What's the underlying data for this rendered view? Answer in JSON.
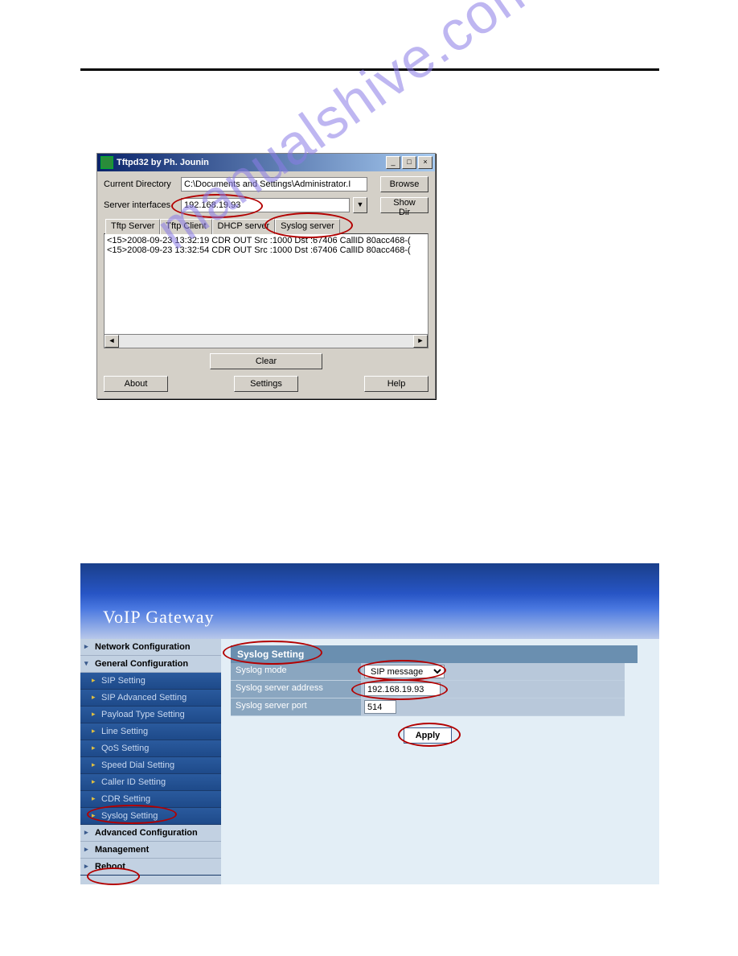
{
  "watermark": "manualshive.com",
  "tftpd": {
    "title": "Tftpd32 by Ph. Jounin",
    "dir_label": "Current Directory",
    "dir_value": "C:\\Documents and Settings\\Administrator.I",
    "browse": "Browse",
    "iface_label": "Server interfaces",
    "iface_value": "192.168.19.93",
    "showdir": "Show Dir",
    "tabs": {
      "tftp_server": "Tftp Server",
      "tftp_client": "Tftp Client",
      "dhcp_server": "DHCP server",
      "syslog_server": "Syslog server"
    },
    "log": [
      "<15>2008-09-23 13:32:19 CDR  OUT Src :1000 Dst :67406 CallID 80acc468-(",
      "<15>2008-09-23 13:32:54 CDR  OUT Src :1000 Dst :67406 CallID 80acc468-("
    ],
    "clear": "Clear",
    "about": "About",
    "settings": "Settings",
    "help": "Help"
  },
  "voip": {
    "header": "VoIP  Gateway",
    "nav": {
      "network": "Network Configuration",
      "general": "General Configuration",
      "items": [
        "SIP Setting",
        "SIP Advanced Setting",
        "Payload Type Setting",
        "Line Setting",
        "QoS Setting",
        "Speed Dial Setting",
        "Caller ID Setting",
        "CDR Setting",
        "Syslog Setting"
      ],
      "advanced": "Advanced Configuration",
      "management": "Management",
      "reboot": "Reboot"
    },
    "panel": {
      "title": "Syslog Setting",
      "mode_label": "Syslog mode",
      "mode_value": "SIP message",
      "addr_label": "Syslog server address",
      "addr_value": "192.168.19.93",
      "port_label": "Syslog server port",
      "port_value": "514",
      "apply": "Apply"
    }
  }
}
